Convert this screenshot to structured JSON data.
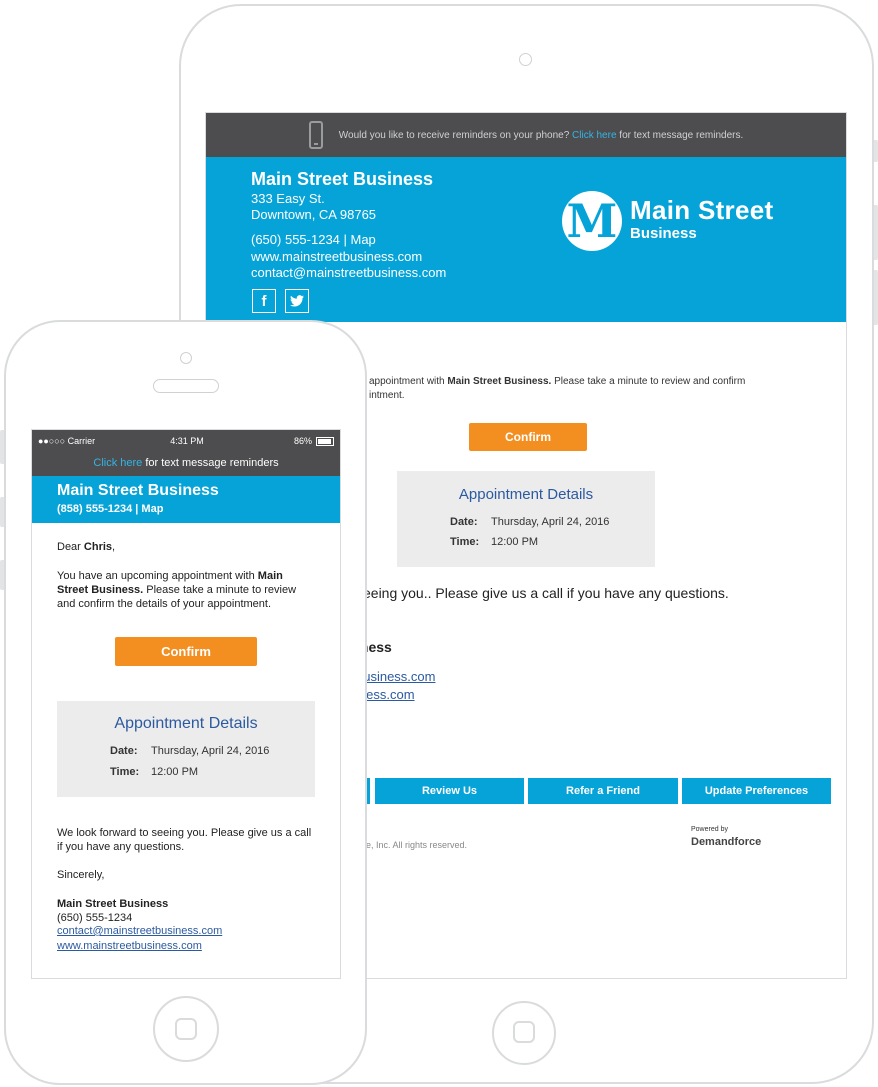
{
  "tablet": {
    "topbar_text": "Would you like to receive reminders on your phone?",
    "topbar_link": "Click here",
    "topbar_suffix": "for text message reminders.",
    "business_name": "Main Street Business",
    "address_line1": "333 Easy St.",
    "address_line2": "Downtown, CA 98765",
    "phone_line": "(650) 555-1234 | Map",
    "website": "www.mainstreetbusiness.com",
    "email": "contact@mainstreetbusiness.com",
    "logo_letter": "M",
    "logo_name": "Main Street",
    "logo_sub": "Business",
    "body_line1_pre": "appointment with ",
    "body_line1_bold": "Main Street Business.",
    "body_line1_post": " Please take a minute to review and confirm",
    "body_line2": "intment.",
    "confirm_label": "Confirm",
    "appt_title": "Appointment Details",
    "appt_date_label": "Date:",
    "appt_date": "Thursday, April 24, 2016",
    "appt_time_label": "Time:",
    "appt_time": "12:00 PM",
    "look_forward": "seeing you.. Please give us a call if you have any questions.",
    "sig_name": "iness",
    "sig_link1": "business.com",
    "sig_link2": "iness.com",
    "footer_buttons": [
      "Review Us",
      "Refer a Friend",
      "Update Preferences"
    ],
    "copyright": "e, Inc. All rights reserved.",
    "powered_by": "Powered by",
    "brand": "Demandforce"
  },
  "phone": {
    "carrier": "●●○○○ Carrier",
    "time": "4:31 PM",
    "battery": "86%",
    "reminder_link": "Click here",
    "reminder_text": "for text message reminders",
    "business_name": "Main Street Business",
    "business_line": "(858) 555-1234 | Map",
    "greeting_pre": "Dear ",
    "greeting_name": "Chris",
    "greeting_post": ",",
    "body1_pre": "You have an upcoming appointment with ",
    "body1_bold1": "Main",
    "body2_bold": "Street Business.",
    "body2_post": " Please take a minute to review",
    "body3": "and confirm the details of your appointment.",
    "confirm_label": "Confirm",
    "appt_title": "Appointment Details",
    "appt_date_label": "Date:",
    "appt_date": "Thursday, April 24, 2016",
    "appt_time_label": "Time:",
    "appt_time": "12:00 PM",
    "lookfwd1": "We look forward to seeing you. Please give us a call",
    "lookfwd2": "if you have any questions.",
    "sincerely": "Sincerely,",
    "sig_name": "Main Street Business",
    "sig_phone": "(650) 555-1234",
    "sig_email": "contact@mainstreetbusiness.com",
    "sig_web": "www.mainstreetbusiness.com"
  },
  "colors": {
    "brand_blue": "#06a3d8",
    "confirm_orange": "#f38f21",
    "dark_bar": "#4d4d4f",
    "link_blue": "#2c5aa0"
  }
}
